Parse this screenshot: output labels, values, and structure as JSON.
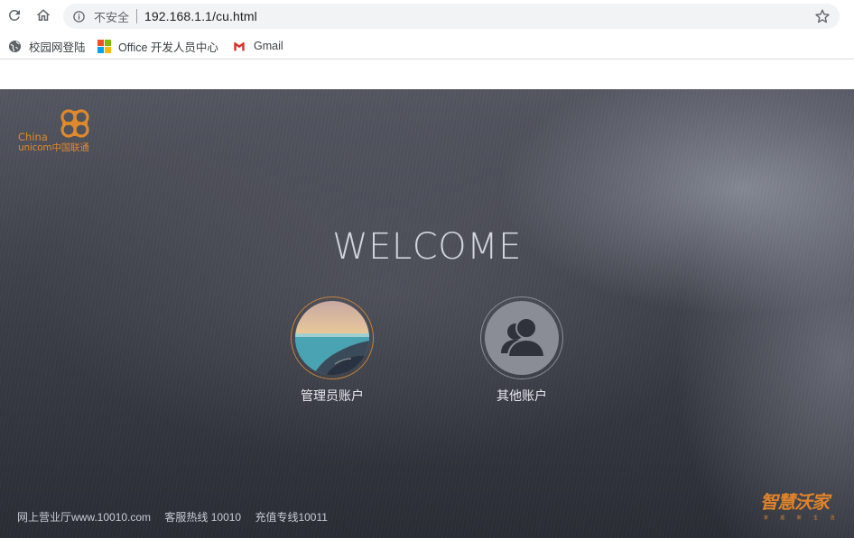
{
  "browser": {
    "url": "192.168.1.1/cu.html",
    "security_label": "不安全",
    "icons": [
      "reload-icon",
      "home-icon",
      "info-icon",
      "star-icon"
    ]
  },
  "bookmarks": [
    {
      "label": "校园网登陆",
      "icon": "globe-icon"
    },
    {
      "label": "Office 开发人员中心",
      "icon": "microsoft-icon"
    },
    {
      "label": "Gmail",
      "icon": "gmail-icon"
    }
  ],
  "page": {
    "logo": {
      "line1": "China",
      "line2": "unicom中国联通"
    },
    "welcome": "WELCOME",
    "accounts": [
      {
        "label": "管理员账户",
        "icon": "landscape-avatar-icon"
      },
      {
        "label": "其他账户",
        "icon": "users-avatar-icon"
      }
    ],
    "footer": {
      "site": "网上营业厅www.10010.com",
      "hotline": "客服热线 10010",
      "recharge": "充值专线10011"
    },
    "brand": {
      "title": "智慧沃家",
      "subtitle": "家 庭 新 生 活"
    },
    "colors": {
      "accent": "#e08a2a",
      "background": "#3f414b"
    }
  }
}
